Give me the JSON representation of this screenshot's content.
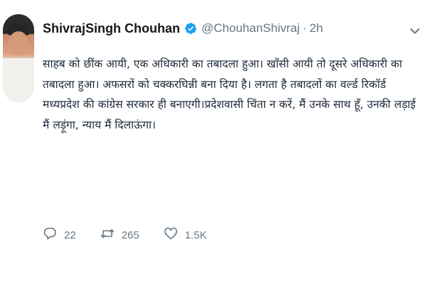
{
  "tweet": {
    "author_name": "ShivrajSingh Chouhan",
    "handle": "@ChouhanShivraj",
    "separator": "·",
    "time": "2h",
    "text_lines": [
      "साहब को छींक आयी, एक अधिकारी का तबादला हुआ। खाँसी आयी तो दूसरे अधिकारी का",
      "तबादला हुआ। अफसरों को चक्करघिन्नी बना दिया है। लगता है तबादलों का वर्ल्ड रिकॉर्ड",
      "मध्यप्रदेश की कांग्रेस सरकार ही बनाएगी।प्रदेशवासी चिंता न करें, मैं उनके साथ हूँ, उनकी लड़ाई",
      "मैं लड़ूंगा, न्याय मैं दिलाऊंगा।"
    ]
  },
  "actions": {
    "replies": "22",
    "retweets": "265",
    "likes": "1.5K"
  },
  "icons": {
    "avatar": "profile-photo",
    "verified": "verified-badge-icon",
    "caret": "chevron-down-icon",
    "reply": "reply-bubble-icon",
    "retweet": "retweet-icon",
    "like": "heart-icon"
  },
  "colors": {
    "verified_blue": "#1da1f2",
    "secondary_text": "#657786",
    "primary_text": "#14171a"
  }
}
